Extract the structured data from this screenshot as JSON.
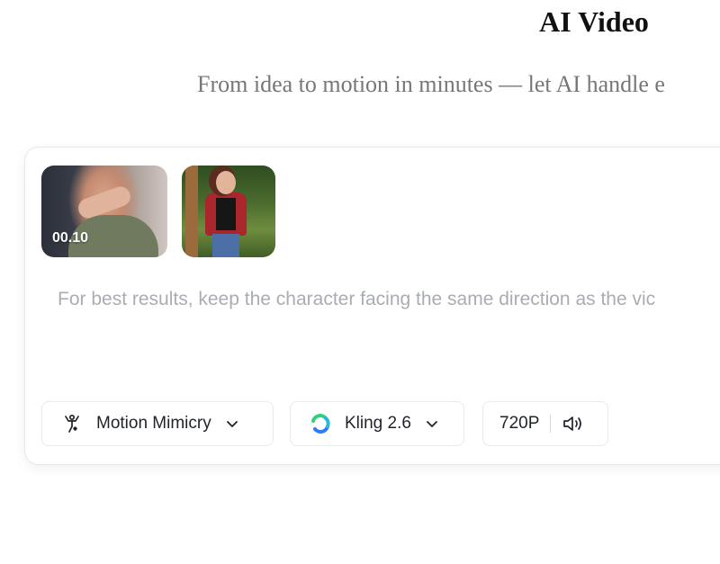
{
  "hero": {
    "title": "AI Video",
    "subtitle": "From idea to motion in minutes — let AI handle e"
  },
  "composer": {
    "attachments": [
      {
        "type": "video",
        "duration": "00.10"
      },
      {
        "type": "image"
      }
    ],
    "prompt_placeholder": "For best results, keep the character facing the same direction as the vic"
  },
  "controls": {
    "mode": {
      "label": "Motion Mimicry",
      "icon": "motion-person-icon"
    },
    "model": {
      "label": "Kling 2.6",
      "icon": "kling-logo-icon"
    },
    "resolution": {
      "label": "720P",
      "icon": "speaker-icon"
    }
  },
  "colors": {
    "text_primary": "#1f2329",
    "text_muted": "#a9adb3",
    "border": "#e6e8eb",
    "kling_green": "#2fd27a",
    "kling_blue": "#2b7cff"
  }
}
